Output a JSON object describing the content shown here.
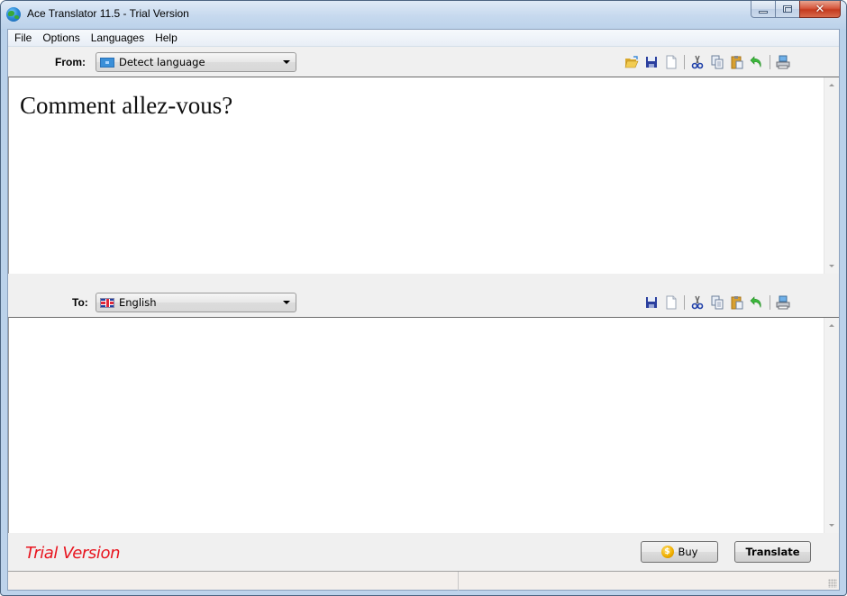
{
  "window": {
    "title": "Ace Translator 11.5 - Trial Version",
    "app_icon": "globe-icon",
    "controls": {
      "minimize": "minimize-icon",
      "maximize": "maximize-icon",
      "close": "close-icon"
    }
  },
  "menubar": {
    "items": [
      {
        "label": "File"
      },
      {
        "label": "Options"
      },
      {
        "label": "Languages"
      },
      {
        "label": "Help"
      }
    ]
  },
  "source": {
    "label": "From:",
    "language": "Detect language",
    "language_icon": "detect-language-icon",
    "text": "Comment allez-vous?",
    "toolbar": [
      "open-folder-icon",
      "save-icon",
      "new-document-icon",
      "separator",
      "cut-icon",
      "copy-icon",
      "paste-icon",
      "undo-icon",
      "separator",
      "print-icon"
    ]
  },
  "target": {
    "label": "To:",
    "language": "English",
    "language_icon": "uk-flag-icon",
    "text": "",
    "toolbar": [
      "save-icon",
      "new-document-icon",
      "separator",
      "cut-icon",
      "copy-icon",
      "paste-icon",
      "undo-icon",
      "separator",
      "print-icon"
    ]
  },
  "footer": {
    "trial_label": "Trial Version",
    "buy_label": "Buy",
    "translate_label": "Translate"
  },
  "statusbar": {
    "left": "",
    "right": ""
  },
  "colors": {
    "trial_text": "#e8151f",
    "title_bar": "#c6d9ee",
    "close_button": "#c43a1f"
  }
}
